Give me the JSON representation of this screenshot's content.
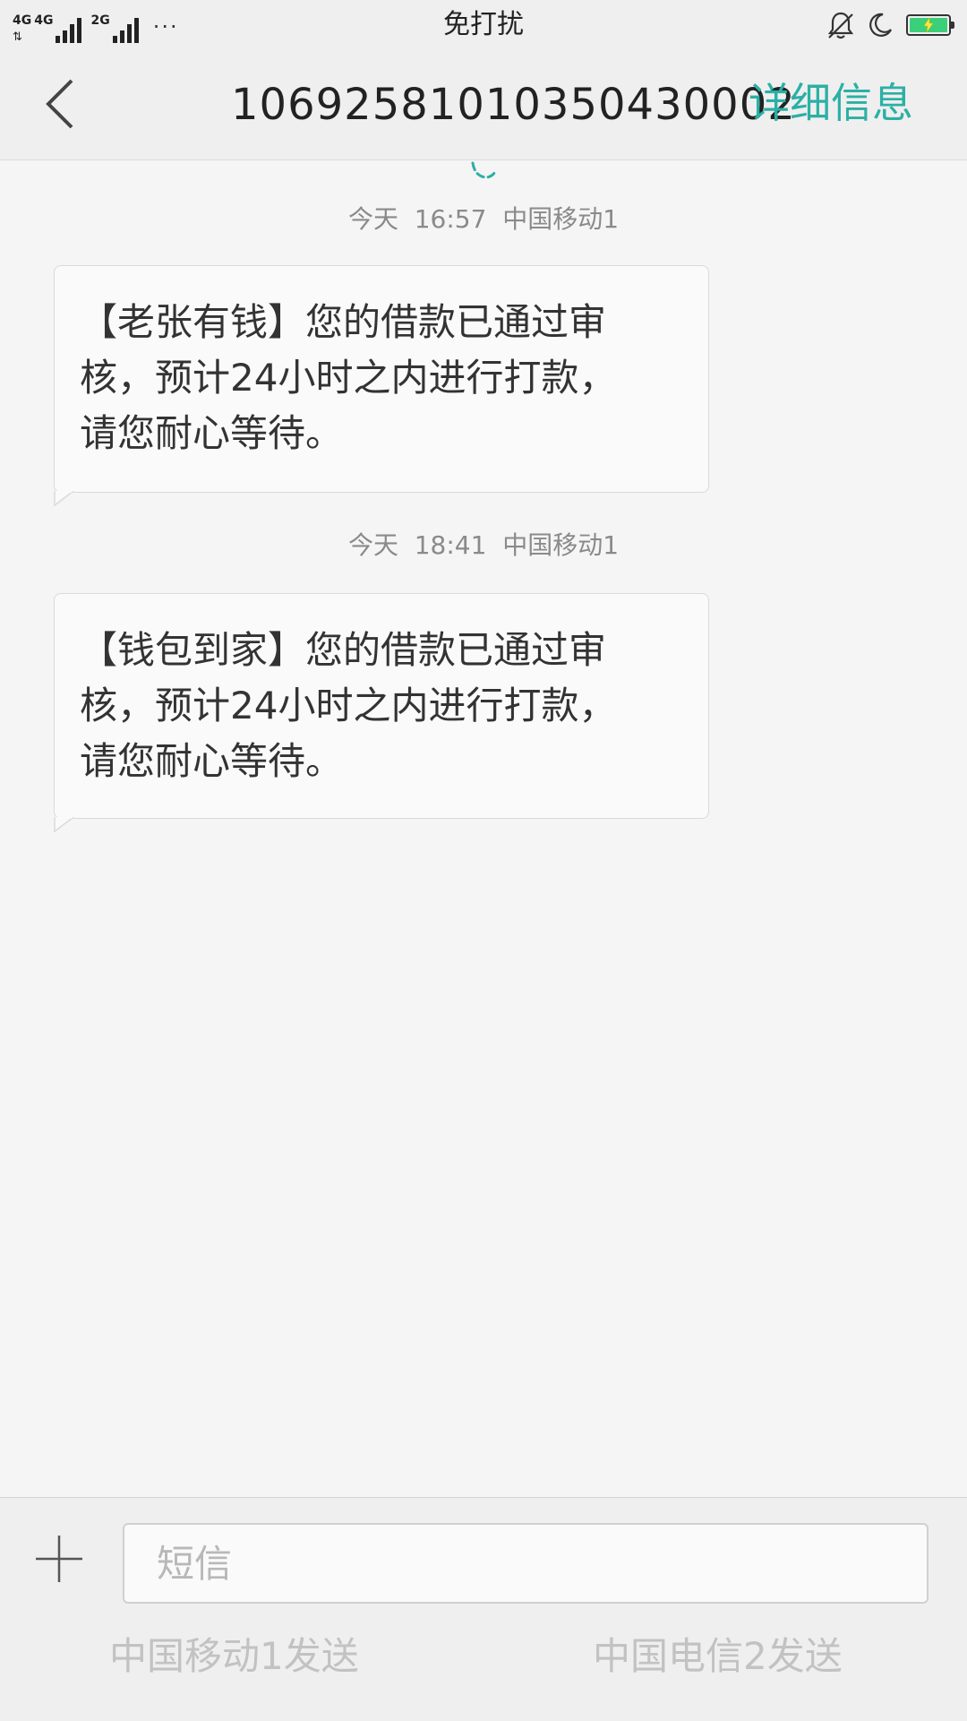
{
  "status_bar": {
    "network_1": "4G",
    "network_2": "4G",
    "network_3": "2G",
    "more_dots": "···",
    "title": "免打扰",
    "battery_level": 1.0,
    "battery_color": "#3ad07a"
  },
  "header": {
    "title": "1069258101035043000​2",
    "details_label": "详细信息",
    "accent_color": "#2bb0a5"
  },
  "messages": [
    {
      "time": "今天  16:57  中国移动1",
      "text": "【老张有钱】您的借款已通过审核，预计24小时之内进行打款，请您耐心等待。"
    },
    {
      "time": "今天  18:41  中国移动1",
      "text": "【钱包到家】您的借款已通过审核，预计24小时之内进行打款，请您耐心等待。"
    }
  ],
  "composer": {
    "placeholder": "短信",
    "value": "",
    "send_sim1_label": "中国移动1发送",
    "send_sim2_label": "中国电信2发送"
  }
}
